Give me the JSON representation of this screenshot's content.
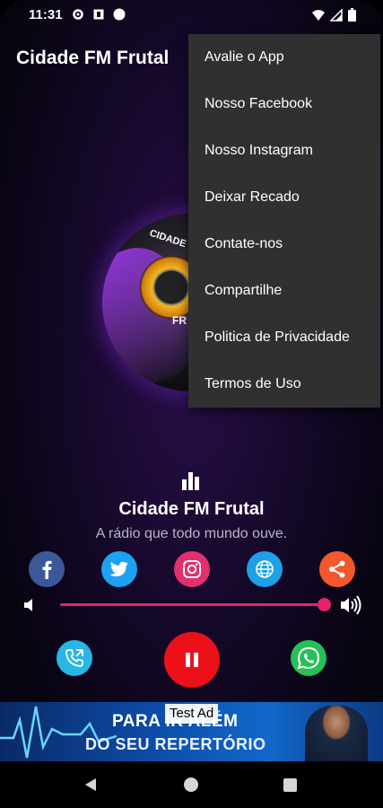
{
  "status_bar": {
    "time": "11:31"
  },
  "app_bar": {
    "title": "Cidade FM Frutal"
  },
  "logo": {
    "top_text": "CIDADE",
    "bottom_text": "FR"
  },
  "menu": {
    "items": [
      {
        "label": "Avalie o App"
      },
      {
        "label": "Nosso Facebook"
      },
      {
        "label": "Nosso Instagram"
      },
      {
        "label": "Deixar Recado"
      },
      {
        "label": "Contate-nos"
      },
      {
        "label": "Compartilhe"
      },
      {
        "label": "Politica de Privacidade"
      },
      {
        "label": "Termos de Uso"
      }
    ]
  },
  "player": {
    "station_name": "Cidade FM Frutal",
    "slogan": "A rádio que todo mundo ouve.",
    "volume_level": 1.0
  },
  "social": [
    {
      "name": "facebook",
      "color": "#3b5998"
    },
    {
      "name": "twitter",
      "color": "#1da1f2"
    },
    {
      "name": "instagram",
      "color": "#e1306c"
    },
    {
      "name": "website",
      "color": "#1e9fe6"
    },
    {
      "name": "share",
      "color": "#f3582c"
    }
  ],
  "ad": {
    "label": "Test Ad",
    "line1": "PARA IR ALÉM",
    "line2": "DO SEU REPERTÓRIO"
  },
  "colors": {
    "accent": "#e8216f",
    "play": "#ec1119",
    "whatsapp": "#25c05a",
    "call": "#27b6e6"
  }
}
